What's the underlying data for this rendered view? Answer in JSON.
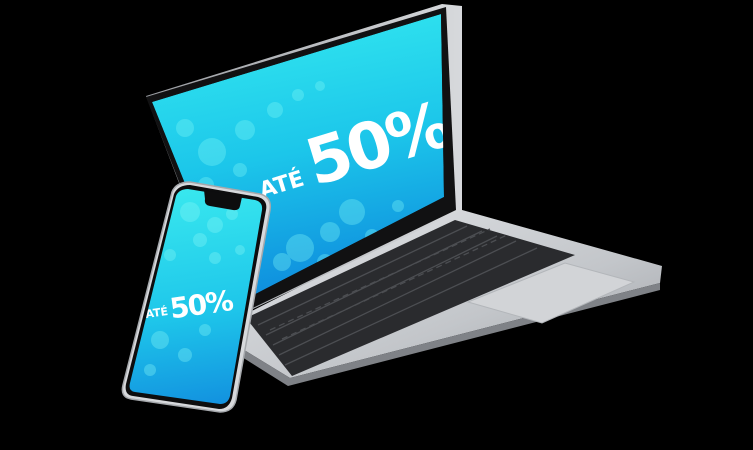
{
  "promo": {
    "prefix": "ATÉ",
    "value": "50%"
  },
  "colors": {
    "background": "#000000",
    "screen_top": "#2fe6ee",
    "screen_bottom": "#1296e0",
    "screen_text": "#ffffff",
    "laptop_body": "#c9ccd0",
    "laptop_bezel": "#111111",
    "keyboard": "#2a2b2e",
    "phone_frame": "#d8dadd"
  },
  "icons": {
    "laptop": "laptop-device",
    "phone": "smartphone-device"
  }
}
